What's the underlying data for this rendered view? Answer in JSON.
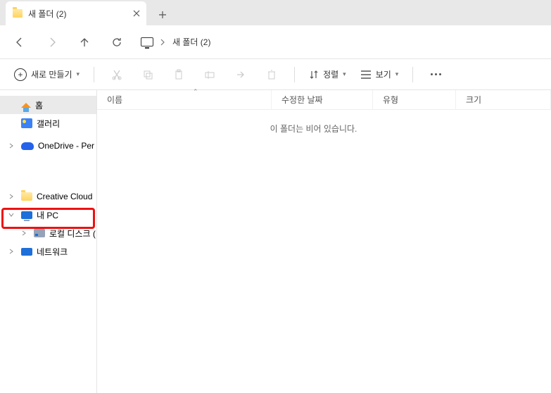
{
  "tab": {
    "title": "새 폴더 (2)"
  },
  "path": {
    "current": "새 폴더 (2)"
  },
  "toolbar": {
    "new_label": "새로 만들기",
    "sort_label": "정렬",
    "view_label": "보기"
  },
  "nav": {
    "home": "홈",
    "gallery": "갤러리",
    "onedrive": "OneDrive - Per",
    "creative_cloud": "Creative Cloud",
    "this_pc": "내 PC",
    "local_disk": "로컬 디스크 (",
    "network": "네트워크"
  },
  "columns": {
    "name": "이름",
    "date": "수정한 날짜",
    "type": "유형",
    "size": "크기"
  },
  "empty_message": "이 폴더는 비어 있습니다."
}
